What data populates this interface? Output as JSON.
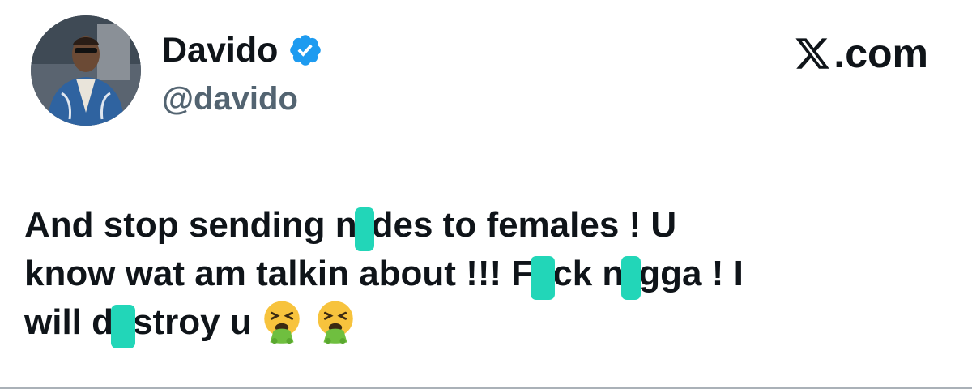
{
  "author": {
    "name": "Davido",
    "handle": "@davido",
    "verified": true,
    "verified_color": "#1d9bf0"
  },
  "brand": {
    "logo_icon": "x-logo-icon",
    "suffix": ".com"
  },
  "tweet": {
    "lines": [
      [
        "And stop sending n",
        "[censor]",
        "des to females ! U"
      ],
      [
        "know wat am talkin about !!! F",
        "[censor]",
        "ck n",
        "[censor]",
        "gga ! I"
      ],
      [
        "will d",
        "[censor]",
        "stroy u",
        "[emoji:nauseated-vomiting-face]",
        "[emoji:nauseated-vomiting-face]"
      ]
    ],
    "segments": {
      "l1a": "And stop sending n",
      "l1b": "des to females ! U",
      "l2a": "know wat am talkin about !!! F",
      "l2b": "ck n",
      "l2c": "gga ! I",
      "l3a": "will d",
      "l3b": "stroy u"
    },
    "censor_color": "#22d6b8",
    "emoji_icons": [
      "vomiting-face-icon",
      "vomiting-face-icon"
    ]
  }
}
